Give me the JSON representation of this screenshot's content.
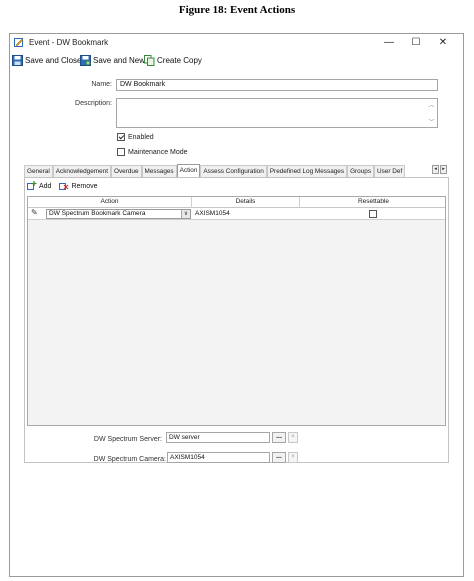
{
  "caption": "Figure 18:  Event Actions",
  "window": {
    "title": "Event  -  DW Bookmark",
    "minimize": "—",
    "maximize": "☐",
    "close": "✕"
  },
  "toolbar": {
    "save_close": "Save and Close",
    "save_new": "Save and New",
    "create_copy": "Create Copy"
  },
  "form": {
    "name_label": "Name:",
    "name_value": "DW Bookmark",
    "description_label": "Description:",
    "description_value": "",
    "enabled_label": "Enabled",
    "enabled_checked": true,
    "maintenance_label": "Maintenance Mode",
    "maintenance_checked": false
  },
  "tabs": [
    {
      "label": "General",
      "active": false
    },
    {
      "label": "Acknowledgement",
      "active": false
    },
    {
      "label": "Overdue",
      "active": false
    },
    {
      "label": "Messages",
      "active": false
    },
    {
      "label": "Action",
      "active": true
    },
    {
      "label": "Assess Configuration",
      "active": false
    },
    {
      "label": "Predefined Log Messages",
      "active": false
    },
    {
      "label": "Groups",
      "active": false
    },
    {
      "label": "User Def",
      "active": false
    }
  ],
  "tab_scroll": {
    "left": "◂",
    "right": "▸"
  },
  "action_panel": {
    "add_label": "Add",
    "remove_label": "Remove",
    "columns": {
      "action": "Action",
      "details": "Details",
      "resettable": "Resettable"
    },
    "rows": [
      {
        "indicator": "✎",
        "action": "DW Spectrum Bookmark Camera",
        "details": "AXISM1054",
        "resettable": false
      }
    ]
  },
  "bottom": {
    "server_label": "DW Spectrum Server:",
    "server_value": "DW server",
    "camera_label": "DW Spectrum Camera:",
    "camera_value": "AXISM1054",
    "browse": "...",
    "clear": "×"
  },
  "colors": {
    "accent_blue": "#2d6db5",
    "save_green": "#3a8a3a",
    "window_border": "#9a9a9a"
  }
}
